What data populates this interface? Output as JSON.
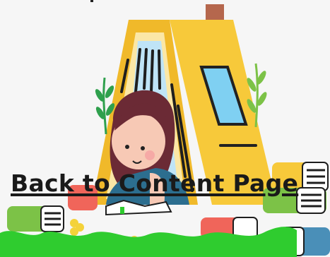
{
  "page": {
    "back_link_label": "Back to Content Page"
  },
  "illustration": {
    "subject": "girl reading a book under a tent with house-shaped roof",
    "colors": {
      "roof": "#f7c93a",
      "roof_dark": "#e7ae1f",
      "window": "#7fd0f2",
      "chimney": "#b5674d",
      "hair": "#6b2a35",
      "skin": "#f7c9b5",
      "shirt": "#2c6e8f",
      "grass": "#2fcc2f",
      "leaf": "#2fa04d",
      "flower": "#f4d23a"
    }
  }
}
